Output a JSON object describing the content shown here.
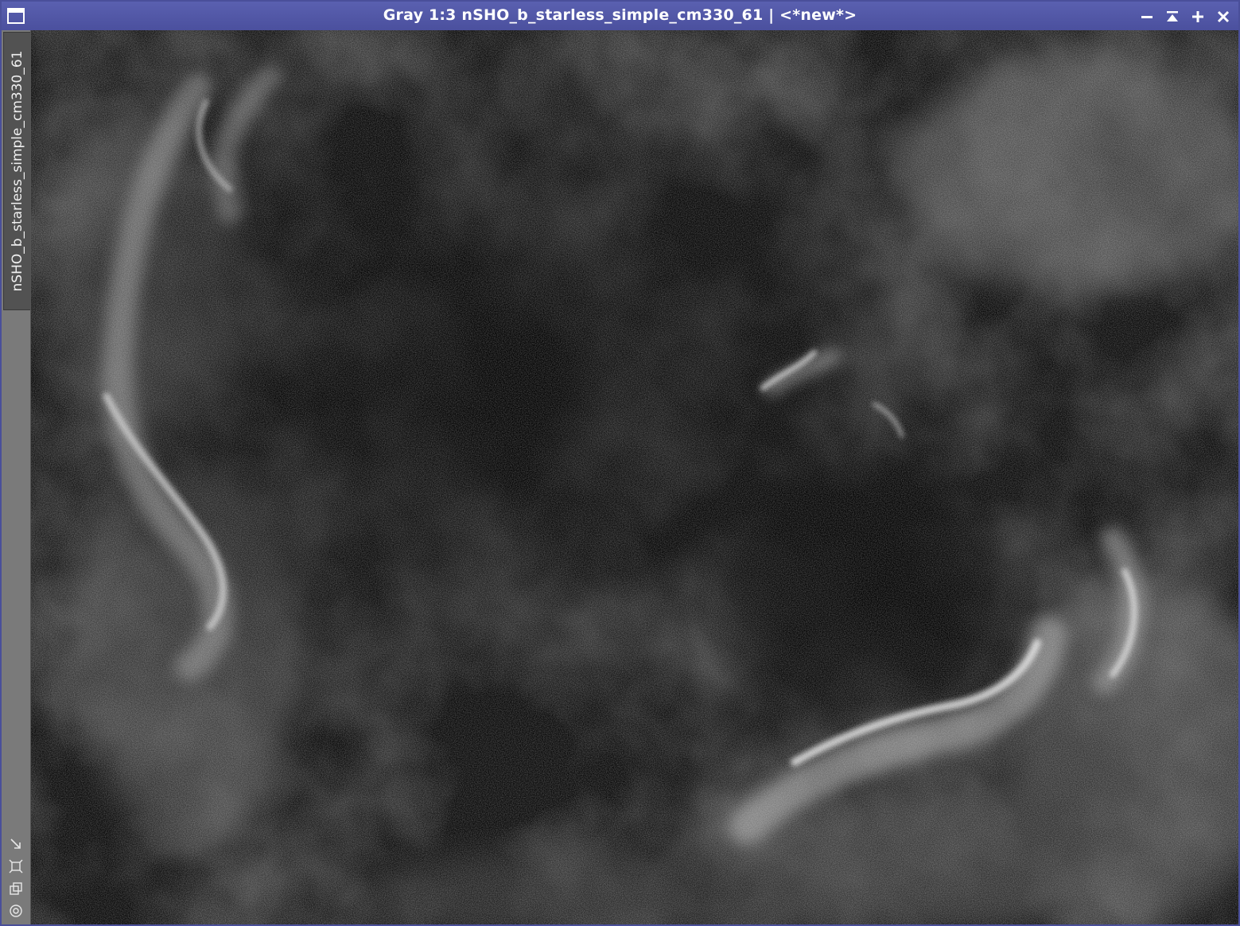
{
  "window": {
    "title": "Gray 1:3 nSHO_b_starless_simple_cm330_61 | <*new*>",
    "icon": "window-icon",
    "controls": [
      {
        "name": "minimize-icon"
      },
      {
        "name": "shade-icon"
      },
      {
        "name": "maximize-icon"
      },
      {
        "name": "close-icon"
      }
    ]
  },
  "sidebar": {
    "tab_label": "nSHO_b_starless_simple_cm330_61",
    "tools": [
      {
        "name": "resize-arrow-icon"
      },
      {
        "name": "crop-frame-icon"
      },
      {
        "name": "clone-icon"
      },
      {
        "name": "target-icon"
      }
    ]
  },
  "image": {
    "mode": "grayscale",
    "description_colors": {
      "background": "#050505",
      "nebula": "#cfcfcf"
    }
  },
  "colors": {
    "titlebar": "#4b509e",
    "sidebar": "#7a7a7a",
    "tab": "#525252"
  }
}
